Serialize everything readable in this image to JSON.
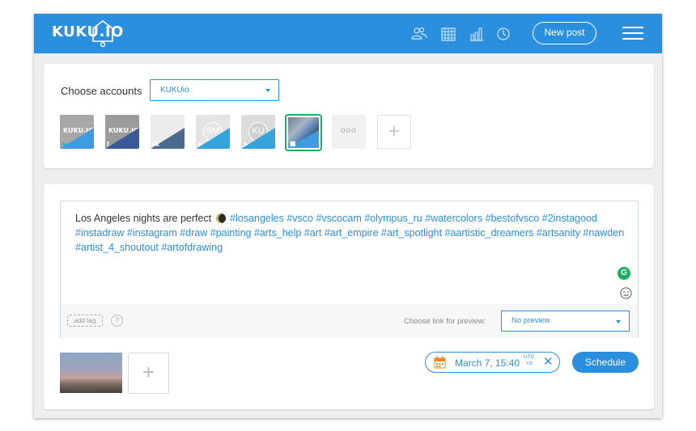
{
  "header": {
    "logo_text": "KUKU.IO",
    "icons": [
      "users-icon",
      "calendar-icon",
      "analytics-icon",
      "clock-icon",
      "menu-icon"
    ],
    "new_post_label": "New post",
    "brand_color": "#2b8fe0"
  },
  "accounts": {
    "label": "Choose accounts",
    "selected_group": "KUKUio",
    "items": [
      {
        "network": "twitter",
        "badge": "🐦",
        "text": "KUKU.IO",
        "selected": false
      },
      {
        "network": "facebook",
        "badge": "f",
        "text": "KUKU.IO",
        "selected": false
      },
      {
        "network": "vk",
        "badge": "vk",
        "text": "",
        "selected": false
      },
      {
        "network": "telegram",
        "badge": "➤",
        "text": "SM",
        "selected": false
      },
      {
        "network": "telegram",
        "badge": "➤",
        "text": "KU",
        "selected": false
      },
      {
        "network": "instagram",
        "badge": "▣",
        "text": "",
        "selected": true
      }
    ],
    "more_label": "ooo",
    "add_label": "+"
  },
  "composer": {
    "text_plain": "Los Angeles nights are perfect",
    "text_tags": "#losangeles #vsco #vscocam #olympus_ru #watercolors #bestofvsco #2instagood #instadraw #instagram #draw #painting #arts_help #art #art_empire #art_spotlight #aartistic_dreamers #artsanity #nawden #artist_4_shoutout #artofdrawing",
    "grammarly_label": "G",
    "add_tag_label": "add tag",
    "help_label": "?",
    "link_preview_label": "Choose link for preview:",
    "link_preview_value": "No preview"
  },
  "schedule": {
    "date_label": "March 7, 15:40",
    "tz_line1": "UTC",
    "tz_line2": "+3",
    "close_label": "✕",
    "button_label": "Schedule",
    "add_media_label": "+"
  }
}
